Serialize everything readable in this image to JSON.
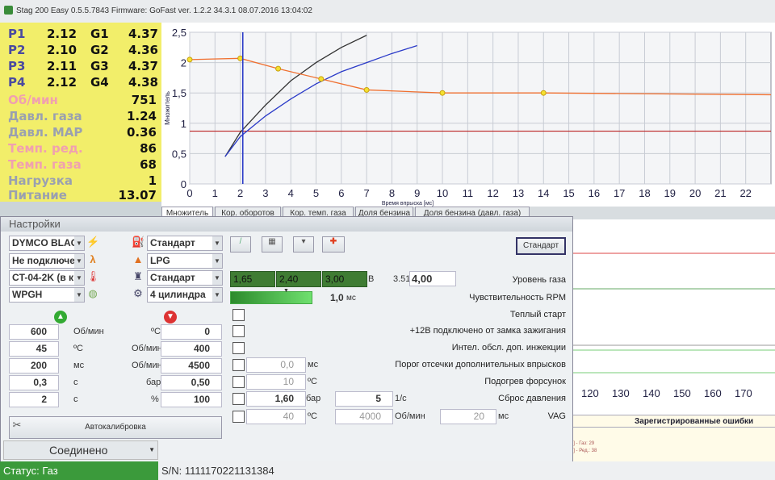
{
  "window": {
    "title": "Stag 200 Easy 0.5.5.7843 Firmware: GoFast  ver. 1.2.2  34.3.1   08.07.2016 13:04:02"
  },
  "injectors": [
    {
      "p": "P1",
      "p_val": "2.12",
      "g": "G1",
      "g_val": "4.37"
    },
    {
      "p": "P2",
      "p_val": "2.10",
      "g": "G2",
      "g_val": "4.36"
    },
    {
      "p": "P3",
      "p_val": "2.11",
      "g": "G3",
      "g_val": "4.37"
    },
    {
      "p": "P4",
      "p_val": "2.12",
      "g": "G4",
      "g_val": "4.38"
    }
  ],
  "params": [
    {
      "label": "Об/мин",
      "value": "751",
      "style": "warm"
    },
    {
      "label": "Давл. газа",
      "value": "1.24",
      "style": "dim"
    },
    {
      "label": "Давл. MAP",
      "value": "0.36",
      "style": "dim"
    },
    {
      "label": "Темп. ред.",
      "value": "86",
      "style": "warm"
    },
    {
      "label": "Темп. газа",
      "value": "68",
      "style": "warm"
    },
    {
      "label": "Нагрузка",
      "value": "1",
      "style": "dim"
    },
    {
      "label": "Питание",
      "value": "13.07",
      "style": "dim"
    }
  ],
  "chart_data": {
    "type": "scatter",
    "title": "",
    "xlabel": "Время впрыска [мс]",
    "ylabel": "Множитель",
    "xlim": [
      0,
      23
    ],
    "ylim": [
      0,
      2.5
    ],
    "x_ticks": [
      "0",
      "1",
      "2",
      "3",
      "4",
      "5",
      "6",
      "7",
      "8",
      "9",
      "10",
      "11",
      "12",
      "13",
      "14",
      "15",
      "16",
      "17",
      "18",
      "19",
      "20",
      "21",
      "22"
    ],
    "y_ticks": [
      "0",
      "0,5",
      "1",
      "1,5",
      "2",
      "2,5"
    ],
    "cursor_x": 2.1,
    "threshold_y": 0.87,
    "multiplier_curve": {
      "x": [
        0,
        2,
        3.5,
        5.2,
        7,
        10,
        14,
        23
      ],
      "y": [
        2.05,
        2.07,
        1.9,
        1.73,
        1.55,
        1.5,
        1.5,
        1.47
      ]
    },
    "black_fit": {
      "x": [
        1.4,
        2,
        3,
        4,
        5,
        6,
        7
      ],
      "y": [
        0.45,
        0.85,
        1.3,
        1.7,
        2.0,
        2.25,
        2.45
      ]
    },
    "blue_fit": {
      "x": [
        1.4,
        2,
        3,
        4,
        5,
        6,
        7,
        8,
        9
      ],
      "y": [
        0.45,
        0.78,
        1.12,
        1.4,
        1.65,
        1.85,
        2.0,
        2.15,
        2.28
      ]
    }
  },
  "tabs": [
    "Множитель",
    "Кор. оборотов",
    "Кор. темп. газа",
    "Доля бензина",
    "Доля бензина (давл. газа)"
  ],
  "settings": {
    "title": "Настройки",
    "left_dropdowns": [
      "DYMCO BLACI",
      "Не подключе",
      "CT-04-2K (в к",
      "WPGH"
    ],
    "right_dropdowns": [
      "Стандарт",
      "LPG",
      "Стандарт",
      "4 цилиндра"
    ],
    "table_rows": [
      {
        "v1": "600",
        "u1": "Об/мин",
        "u2": "ºC",
        "v2": "0"
      },
      {
        "v1": "45",
        "u1": "ºC",
        "u2": "Об/мин",
        "v2": "400"
      },
      {
        "v1": "200",
        "u1": "мс",
        "u2": "Об/мин",
        "v2": "4500"
      },
      {
        "v1": "0,3",
        "u1": "с",
        "u2": "бар",
        "v2": "0,50"
      },
      {
        "v1": "2",
        "u1": "с",
        "u2": "%",
        "v2": "100"
      }
    ],
    "autocalib_label": "Автокалибровка",
    "standard_button": "Стандарт",
    "gas_level": {
      "v1": "1,65",
      "v2": "2,40",
      "v3": "3,00",
      "unit": "В",
      "reading": "3.51",
      "value": "4,00",
      "label": "Уровень газа"
    },
    "rpm_sens": {
      "value": "1,0",
      "unit": "мс",
      "label": "Чувствительность RPM"
    },
    "options": [
      {
        "label": "Теплый старт"
      },
      {
        "label": "+12В подключено от замка зажигания"
      },
      {
        "label": "Интел. обсл. доп. инжекции"
      },
      {
        "label": "Порог отсечки дополнительных впрысков",
        "value": "0,0",
        "unit": "мс"
      },
      {
        "label": "Подогрев форсунок",
        "value": "10",
        "unit": "ºC"
      },
      {
        "label": "Сброс давления",
        "value": "1,60",
        "unit": "бар",
        "value2": "5",
        "unit2": "1/с"
      },
      {
        "label": "VAG",
        "value": "40",
        "unit": "ºC",
        "value2": "4000",
        "unit2": "Об/мин",
        "value3": "20",
        "unit3": "мс"
      }
    ]
  },
  "lower_axis_ticks": [
    "120",
    "130",
    "140",
    "150",
    "160",
    "170"
  ],
  "errors_title": "Зарегистрированные ошибки",
  "errors_lines": [
    "MAP: 0,95",
    "Газ: 1,29",
    "Температура [ºC] - Газ: 29",
    "Температура [ºC] - Ред.: 38"
  ],
  "connection": "Соединено",
  "status": "Статус: Газ",
  "serial": "S/N: 1111170221131384"
}
